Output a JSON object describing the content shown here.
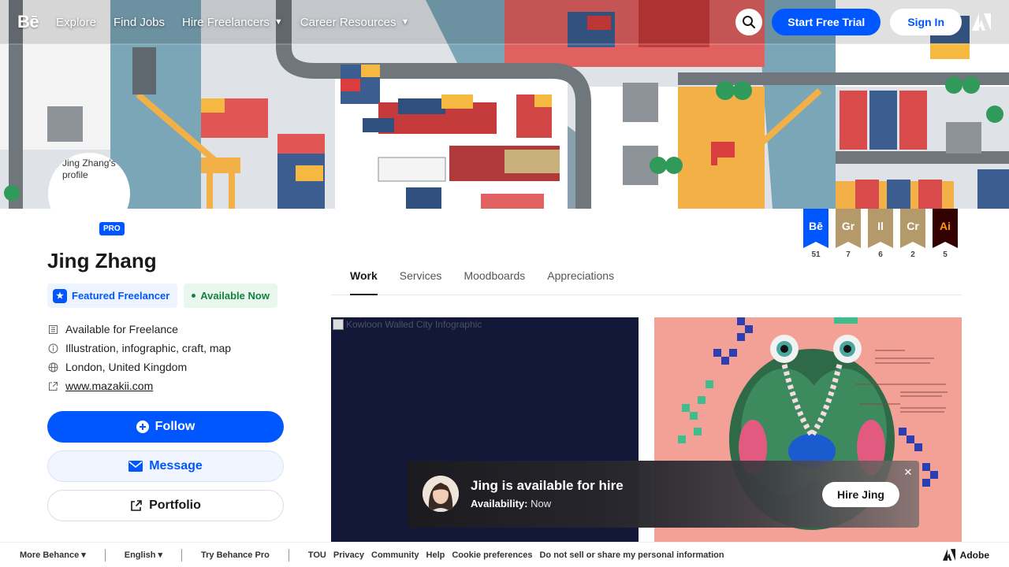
{
  "nav": {
    "logo": "Bē",
    "links": [
      "Explore",
      "Find Jobs",
      "Hire Freelancers",
      "Career Resources"
    ],
    "trial_label": "Start Free Trial",
    "signin_label": "Sign In"
  },
  "profile": {
    "avatar_alt": "Jing Zhang's profile",
    "pro_label": "PRO",
    "name": "Jing Zhang",
    "featured_label": "Featured Freelancer",
    "available_label": "Available Now",
    "details": {
      "freelance": "Available for Freelance",
      "fields": "Illustration, infographic, craft, map",
      "location": "London, United Kingdom",
      "website": "www.mazakii.com"
    },
    "follow_label": "Follow",
    "message_label": "Message",
    "portfolio_label": "Portfolio"
  },
  "apps": [
    {
      "abbr": "Bē",
      "count": "51",
      "color": "#0057ff",
      "text_color": "#ffffff"
    },
    {
      "abbr": "Gr",
      "count": "7",
      "color": "#b4996b",
      "text_color": "#ffffff"
    },
    {
      "abbr": "Il",
      "count": "6",
      "color": "#b4996b",
      "text_color": "#ffffff"
    },
    {
      "abbr": "Cr",
      "count": "2",
      "color": "#b4996b",
      "text_color": "#ffffff"
    },
    {
      "abbr": "Ai",
      "count": "5",
      "color": "#330000",
      "text_color": "#ff9a00"
    }
  ],
  "tabs": [
    "Work",
    "Services",
    "Moodboards",
    "Appreciations"
  ],
  "projects": {
    "card1_alt": "Kowloon Walled City Infographic"
  },
  "toast": {
    "title": "Jing is available for hire",
    "availability_label": "Availability:",
    "availability_value": "Now",
    "hire_label": "Hire Jing"
  },
  "footer": {
    "more": "More Behance",
    "language": "English",
    "try_pro": "Try Behance Pro",
    "links": [
      "TOU",
      "Privacy",
      "Community",
      "Help",
      "Cookie preferences",
      "Do not sell or share my personal information"
    ],
    "adobe": "Adobe"
  }
}
